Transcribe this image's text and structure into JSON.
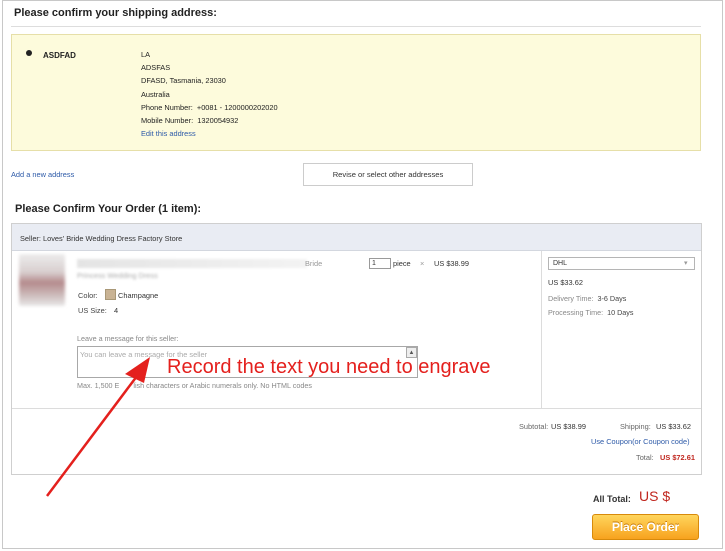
{
  "shipping": {
    "heading": "Please confirm your shipping address:",
    "address": {
      "name": "ASDFAD",
      "line1": "LA",
      "line2": "ADSFAS",
      "line3": "DFASD, Tasmania, 23030",
      "line4": "Australia",
      "phone_label": "Phone Number:",
      "phone_value": "+0081 - 1200000202020",
      "mobile_label": "Mobile Number:",
      "mobile_value": "1320054932",
      "edit_link": "Edit this address"
    },
    "add_new_link": "Add a new address",
    "revise_button": "Revise or select other addresses"
  },
  "order": {
    "heading": "Please Confirm Your Order (1 item):",
    "seller": "Seller: Loves' Bride Wedding Dress Factory Store",
    "item": {
      "title_line1": "",
      "title_tail": "Bride",
      "title_line2": "Princess Wedding Dress",
      "quantity": "1",
      "unit": "piece",
      "times": "×",
      "price": "US $38.99",
      "color_label": "Color:",
      "color_value": "Champagne",
      "color_hex": "#c9b394",
      "size_label": "US Size:",
      "size_value": "4"
    },
    "message": {
      "label": "Leave a message for this seller:",
      "placeholder": "You can leave a message for the seller",
      "note_prefix": "Max. 1,500 E",
      "note_suffix": "lish characters or Arabic numerals only. No HTML codes"
    },
    "shipping_method": {
      "selected": "DHL",
      "cost": "US $33.62",
      "delivery_label": "Delivery Time:",
      "delivery_value": "3-6 Days",
      "processing_label": "Processing Time:",
      "processing_value": "10 Days"
    },
    "summary": {
      "subtotal_label": "Subtotal:",
      "subtotal_value": "US $38.99",
      "shipping_label": "Shipping:",
      "shipping_value": "US $33.62",
      "coupon_link": "Use Coupon(or Coupon code)",
      "total_label": "Total:",
      "total_value": "US $72.61"
    }
  },
  "footer": {
    "all_total_label": "All Total:",
    "all_total_value": "US $",
    "place_order": "Place Order"
  },
  "annotation": {
    "text": "Record the text you need to engrave",
    "color": "#e4201d"
  }
}
